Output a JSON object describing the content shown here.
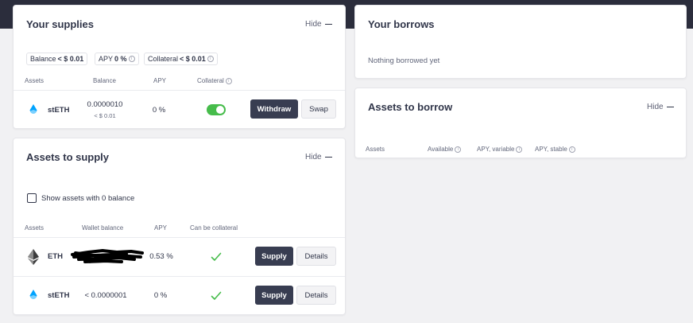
{
  "supplies": {
    "title": "Your supplies",
    "hide_label": "Hide",
    "summary": {
      "balance_label": "Balance",
      "balance_value": "< $ 0.01",
      "apy_label": "APY",
      "apy_value": "0 %",
      "collateral_label": "Collateral",
      "collateral_value": "< $ 0.01"
    },
    "headers": {
      "assets": "Assets",
      "balance": "Balance",
      "apy": "APY",
      "collateral": "Collateral"
    },
    "rows": [
      {
        "asset": "stETH",
        "balance": "0.0000010",
        "balance_usd": "< $ 0.01",
        "apy": "0 %",
        "collateral_enabled": true,
        "withdraw_label": "Withdraw",
        "swap_label": "Swap"
      }
    ]
  },
  "assets_to_supply": {
    "title": "Assets to supply",
    "hide_label": "Hide",
    "show_zero_label": "Show assets with 0 balance",
    "headers": {
      "assets": "Assets",
      "wallet_balance": "Wallet balance",
      "apy": "APY",
      "can_be_collateral": "Can be collateral"
    },
    "rows": [
      {
        "asset": "ETH",
        "wallet_balance": "",
        "apy": "0.53 %",
        "supply_label": "Supply",
        "details_label": "Details"
      },
      {
        "asset": "stETH",
        "wallet_balance": "< 0.0000001",
        "apy": "0 %",
        "supply_label": "Supply",
        "details_label": "Details"
      }
    ]
  },
  "borrows": {
    "title": "Your borrows",
    "empty_text": "Nothing borrowed yet"
  },
  "assets_to_borrow": {
    "title": "Assets to borrow",
    "hide_label": "Hide",
    "headers": {
      "assets": "Assets",
      "available": "Available",
      "apy_variable": "APY, variable",
      "apy_stable": "APY, stable"
    }
  },
  "icons": {
    "steth": "steth-drop-icon",
    "eth": "ethereum-icon",
    "info": "info-icon",
    "check": "check-icon"
  },
  "colors": {
    "header_bg": "#2b2d3c",
    "primary_button": "#383d51",
    "toggle_on": "#46bc4b",
    "check_green": "#46bc4b",
    "steth_blue": "#00a3ff"
  }
}
